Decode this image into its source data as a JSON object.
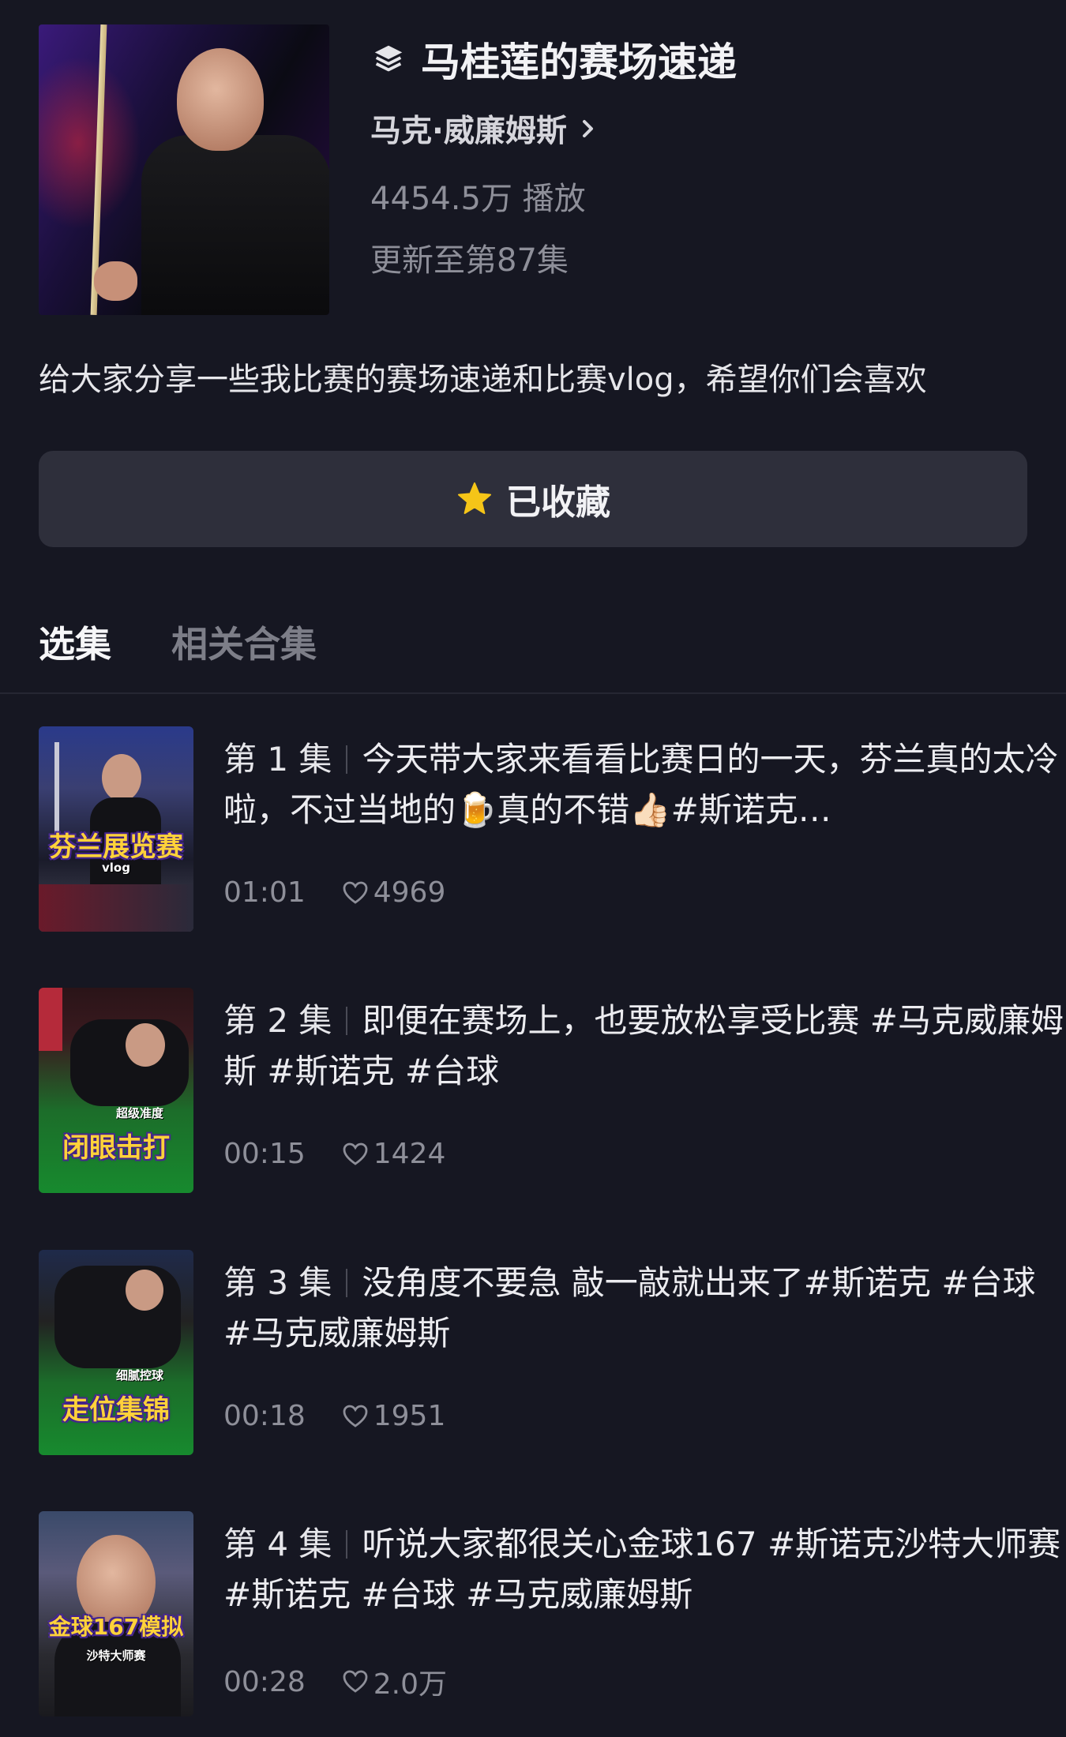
{
  "header": {
    "series_title": "马桂莲的赛场速递",
    "author": "马克·威廉姆斯",
    "plays": "4454.5万 播放",
    "update": "更新至第87集"
  },
  "description": "给大家分享一些我比赛的赛场速递和比赛vlog，希望你们会喜欢",
  "favorite_button": {
    "label": "已收藏",
    "icon": "star-icon",
    "icon_color": "#f5c518"
  },
  "tabs": [
    {
      "label": "选集",
      "active": true
    },
    {
      "label": "相关合集",
      "active": false
    }
  ],
  "episodes": [
    {
      "label": "第 1 集",
      "title": "今天带大家来看看比赛日的一天，芬兰真的太冷啦，不过当地的🍺真的不错👍🏻#斯诺克…",
      "duration": "01:01",
      "likes": "4969",
      "thumb_caption": "芬兰展览赛",
      "thumb_sub": "vlog"
    },
    {
      "label": "第 2 集",
      "title": "即便在赛场上，也要放松享受比赛 #马克威廉姆斯 #斯诺克 #台球",
      "duration": "00:15",
      "likes": "1424",
      "thumb_caption": "闭眼击打",
      "thumb_sub": "超级准度"
    },
    {
      "label": "第 3 集",
      "title": "没角度不要急 敲一敲就出来了#斯诺克 #台球 #马克威廉姆斯",
      "duration": "00:18",
      "likes": "1951",
      "thumb_caption": "走位集锦",
      "thumb_sub": "细腻控球"
    },
    {
      "label": "第 4 集",
      "title": "听说大家都很关心金球167 #斯诺克沙特大师赛 #斯诺克 #台球 #马克威廉姆斯",
      "duration": "00:28",
      "likes": "2.0万",
      "thumb_caption": "金球167模拟",
      "thumb_sub": "沙特大师赛"
    }
  ],
  "colors": {
    "background": "#161722",
    "button_bg": "#2e2f3b",
    "muted_text": "#8e8f99",
    "caption_yellow": "#ffd23a"
  }
}
